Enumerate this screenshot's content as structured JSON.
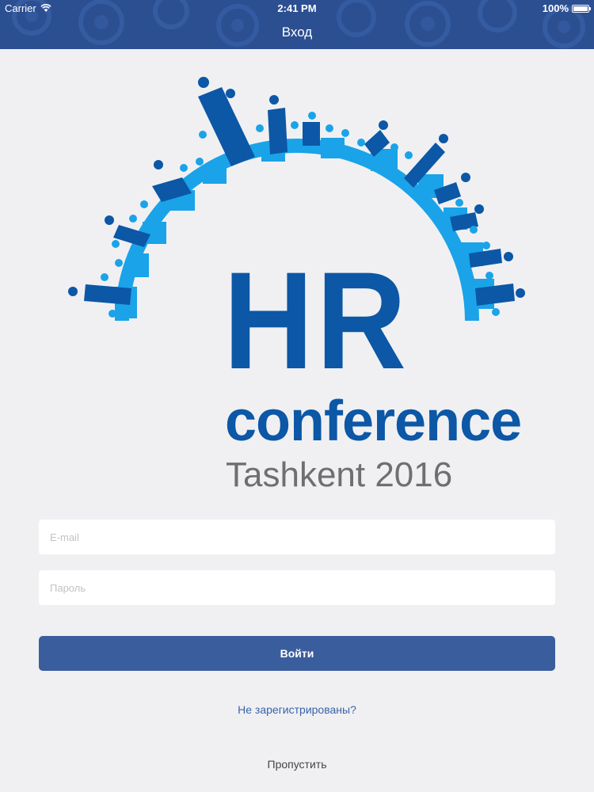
{
  "status_bar": {
    "carrier": "Carrier",
    "time": "2:41 PM",
    "battery": "100%",
    "battery_level": 1.0
  },
  "nav": {
    "title": "Вход"
  },
  "logo": {
    "line1": "HR",
    "line2": "conference",
    "line3": "Tashkent 2016"
  },
  "form": {
    "email_placeholder": "E-mail",
    "password_placeholder": "Пароль",
    "login_label": "Войти"
  },
  "links": {
    "register": "Не зарегистрированы?",
    "skip": "Пропустить"
  },
  "colors": {
    "nav_bg": "#2c4f92",
    "button_bg": "#3a5d9e",
    "logo_dark": "#0c57a6",
    "logo_light": "#1aa3e8",
    "logo_gray": "#6f6f73"
  }
}
